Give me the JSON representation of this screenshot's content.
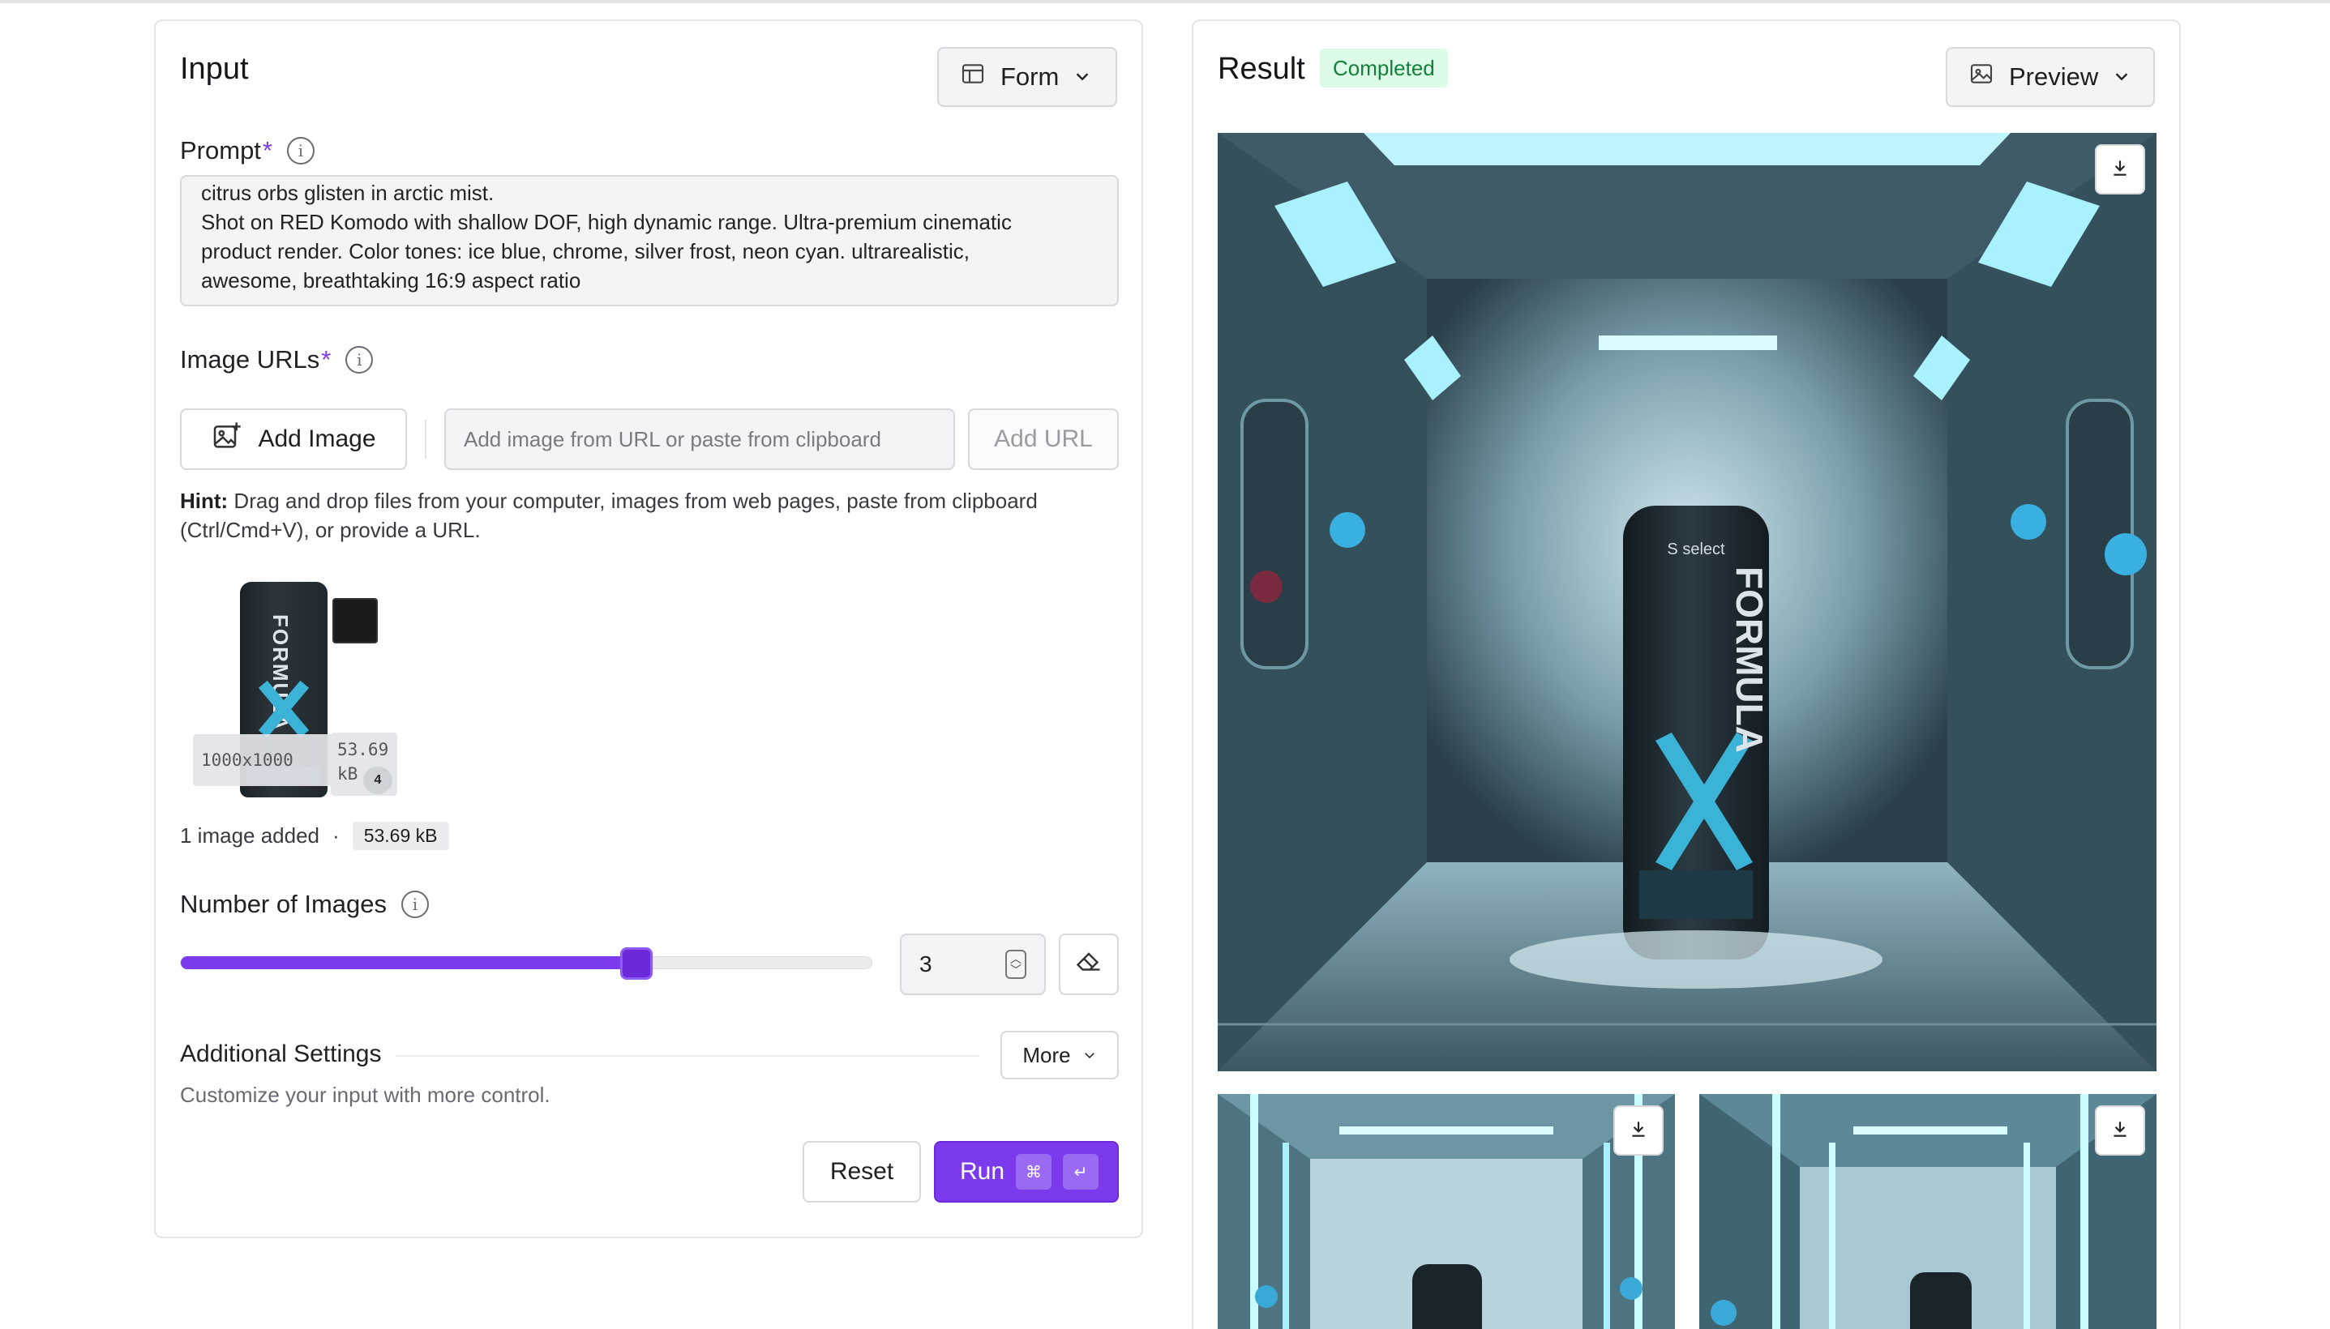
{
  "input": {
    "title": "Input",
    "mode_select": {
      "label": "Form",
      "icon": "table-layout-icon"
    },
    "prompt": {
      "label": "Prompt",
      "required": "*",
      "lines": [
        "citrus orbs glisten in arctic mist.",
        "Shot on RED Komodo with shallow DOF, high dynamic range. Ultra-premium cinematic",
        "product render. Color tones: ice blue, chrome, silver frost, neon cyan. ultrarealistic,",
        "awesome, breathtaking 16:9 aspect ratio"
      ]
    },
    "image_urls": {
      "label": "Image URLs",
      "required": "*",
      "add_image_label": "Add Image",
      "url_placeholder": "Add image from URL or paste from clipboard",
      "add_url_label": "Add URL",
      "hint_bold": "Hint:",
      "hint_line1": " Drag and drop files from your computer, images from web pages, paste from clipboard",
      "hint_line2": "(Ctrl/Cmd+V), or provide a URL.",
      "thumbnail": {
        "dimensions": "1000x1000",
        "size_line1": "53.69",
        "size_line2": "kB",
        "pack_count": "4",
        "can_brand": "FORMULA"
      },
      "images_added": "1 image added",
      "separator": "·",
      "total_size": "53.69 kB"
    },
    "num_images": {
      "label": "Number of Images",
      "value": "3",
      "slider_fraction": 0.66
    },
    "additional": {
      "label": "Additional Settings",
      "more_label": "More",
      "description": "Customize your input with more control."
    },
    "actions": {
      "reset_label": "Reset",
      "run_label": "Run",
      "kbd_cmd": "⌘",
      "kbd_enter": "↵"
    }
  },
  "result": {
    "title": "Result",
    "status": "Completed",
    "view_select": {
      "label": "Preview",
      "icon": "image-icon"
    }
  },
  "colors": {
    "accent": "#7c3aed",
    "status_bg": "#dcfce7",
    "status_text": "#15803d"
  }
}
